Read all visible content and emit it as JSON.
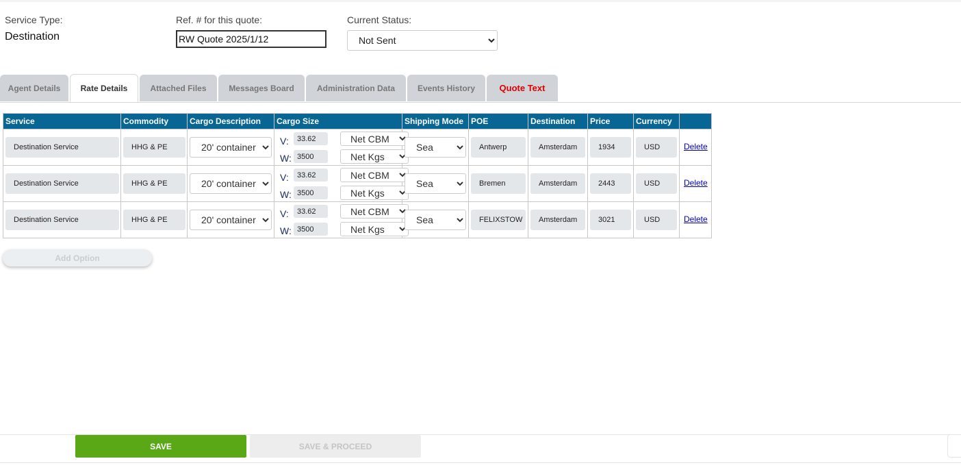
{
  "header": {
    "service_type_label": "Service Type:",
    "service_type_value": "Destination",
    "ref_label": "Ref. # for this quote:",
    "ref_value": "RW Quote 2025/1/12",
    "status_label": "Current Status:",
    "status_value": "Not Sent"
  },
  "tabs": [
    {
      "label": "Agent Details"
    },
    {
      "label": "Rate Details"
    },
    {
      "label": "Attached Files"
    },
    {
      "label": "Messages Board"
    },
    {
      "label": "Administration Data"
    },
    {
      "label": "Events History"
    },
    {
      "label": "Quote Text"
    }
  ],
  "active_tab": "Rate Details",
  "table": {
    "columns": [
      "Service",
      "Commodity",
      "Cargo Description",
      "Cargo Size",
      "Shipping Mode",
      "POE",
      "Destination",
      "Price",
      "Currency",
      ""
    ],
    "v_label": "V:",
    "w_label": "W:",
    "delete_label": "Delete",
    "rows": [
      {
        "service": "Destination Service",
        "commodity": "HHG & PE",
        "cargo_description": "20' container",
        "volume": "33.62",
        "volume_unit": "Net CBM",
        "weight": "3500",
        "weight_unit": "Net Kgs",
        "shipping_mode": "Sea",
        "poe": "Antwerp",
        "destination": "Amsterdam",
        "price": "1934",
        "currency": "USD"
      },
      {
        "service": "Destination Service",
        "commodity": "HHG & PE",
        "cargo_description": "20' container",
        "volume": "33.62",
        "volume_unit": "Net CBM",
        "weight": "3500",
        "weight_unit": "Net Kgs",
        "shipping_mode": "Sea",
        "poe": "Bremen",
        "destination": "Amsterdam",
        "price": "2443",
        "currency": "USD"
      },
      {
        "service": "Destination Service",
        "commodity": "HHG & PE",
        "cargo_description": "20' container",
        "volume": "33.62",
        "volume_unit": "Net CBM",
        "weight": "3500",
        "weight_unit": "Net Kgs",
        "shipping_mode": "Sea",
        "poe": "FELIXSTOW",
        "destination": "Amsterdam",
        "price": "3021",
        "currency": "USD"
      }
    ]
  },
  "add_option_label": "Add Option",
  "footer": {
    "save_label": "SAVE",
    "save_proceed_label": "SAVE & PROCEED"
  },
  "colors": {
    "table_header": "#076694",
    "save_button": "#5aa816",
    "quote_text_tab": "#e00000"
  }
}
